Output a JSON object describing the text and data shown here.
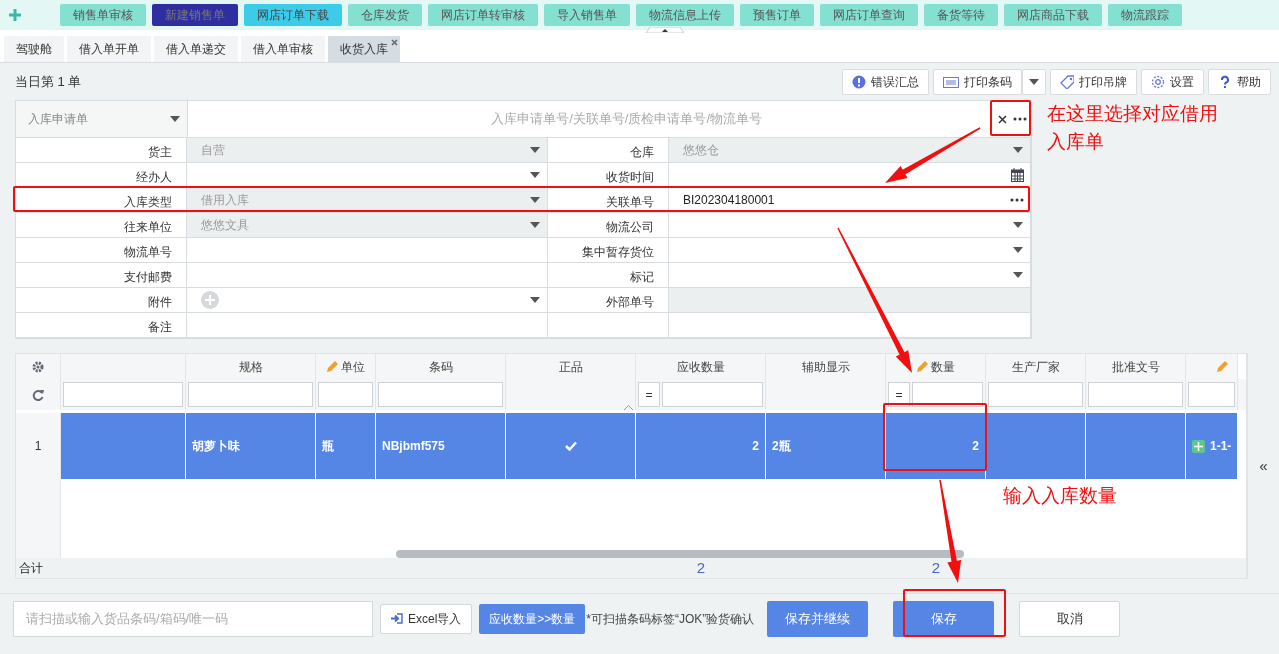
{
  "top_nav": {
    "buttons": [
      {
        "label": "销售单审核",
        "kind": "default"
      },
      {
        "label": "新建销售单",
        "kind": "active"
      },
      {
        "label": "网店订单下载",
        "kind": "hover"
      },
      {
        "label": "仓库发货",
        "kind": "default"
      },
      {
        "label": "网店订单转审核",
        "kind": "default"
      },
      {
        "label": "导入销售单",
        "kind": "default"
      },
      {
        "label": "物流信息上传",
        "kind": "default"
      },
      {
        "label": "预售订单",
        "kind": "default"
      },
      {
        "label": "网店订单查询",
        "kind": "default"
      },
      {
        "label": "备货等待",
        "kind": "default"
      },
      {
        "label": "网店商品下载",
        "kind": "default"
      },
      {
        "label": "物流跟踪",
        "kind": "default"
      }
    ]
  },
  "tabs": [
    {
      "label": "驾驶舱",
      "selected": false
    },
    {
      "label": "借入单开单",
      "selected": false
    },
    {
      "label": "借入单递交",
      "selected": false
    },
    {
      "label": "借入单审核",
      "selected": false
    },
    {
      "label": "收货入库",
      "selected": true
    }
  ],
  "order_count": "当日第 1 单",
  "toolbar": [
    {
      "label": "错误汇总",
      "kind": "plain"
    },
    {
      "label": "打印条码",
      "kind": "split"
    },
    {
      "label": "打印吊牌",
      "kind": "plain"
    },
    {
      "label": "设置",
      "kind": "plain"
    },
    {
      "label": "帮助",
      "kind": "plain"
    }
  ],
  "source": {
    "type": "入库申请单",
    "placeholder": "入库申请单号/关联单号/质检申请单号/物流单号"
  },
  "form": {
    "fields": [
      {
        "label": "货主",
        "value": "自营",
        "kind": "select",
        "disabled": true
      },
      {
        "label": "仓库",
        "value": "悠悠仓",
        "kind": "select",
        "disabled": true
      },
      {
        "label": "经办人",
        "kind": "select",
        "disabled": false
      },
      {
        "label": "收货时间",
        "kind": "date",
        "disabled": false
      },
      {
        "label": "入库类型",
        "value": "借用入库",
        "kind": "select",
        "disabled": true
      },
      {
        "label": "关联单号",
        "value": "BI202304180001",
        "kind": "lookup",
        "disabled": false
      },
      {
        "label": "往来单位",
        "value": "悠悠文具",
        "kind": "select",
        "disabled": true
      },
      {
        "label": "物流公司",
        "kind": "select",
        "disabled": false
      },
      {
        "label": "物流单号",
        "kind": "text",
        "disabled": false
      },
      {
        "label": "集中暂存货位",
        "kind": "select",
        "disabled": false
      },
      {
        "label": "支付邮费",
        "kind": "text",
        "disabled": false
      },
      {
        "label": "标记",
        "kind": "select",
        "disabled": false
      },
      {
        "label": "附件",
        "kind": "attachment",
        "disabled": false
      },
      {
        "label": "外部单号",
        "kind": "text",
        "disabled": true
      },
      {
        "label": "备注",
        "kind": "text",
        "disabled": false
      }
    ]
  },
  "grid": {
    "columns": [
      {
        "kind": "text",
        "editable": false,
        "filterable": true
      },
      {
        "label": "规格",
        "kind": "text",
        "editable": false,
        "filterable": true
      },
      {
        "label": "单位",
        "kind": "text",
        "editable": true,
        "filterable": true
      },
      {
        "label": "条码",
        "kind": "text",
        "editable": false,
        "filterable": true
      },
      {
        "label": "正品",
        "kind": "check",
        "editable": false,
        "filterable": false
      },
      {
        "label": "应收数量",
        "kind": "number",
        "editable": false,
        "filterable": true,
        "operator": "=",
        "total": "2"
      },
      {
        "label": "辅助显示",
        "kind": "text",
        "editable": false,
        "filterable": false
      },
      {
        "label": "数量",
        "kind": "number",
        "editable": true,
        "filterable": true,
        "operator": "=",
        "total": "2"
      },
      {
        "label": "生产厂家",
        "kind": "text",
        "editable": false,
        "filterable": true
      },
      {
        "label": "批准文号",
        "kind": "text",
        "editable": false,
        "filterable": true
      },
      {
        "kind": "location",
        "editable": true,
        "filterable": true
      }
    ],
    "rows": [
      {
        "number": "1",
        "selected": true,
        "cells": [
          {
            "kind": "blank"
          },
          {
            "text": "胡萝卜味"
          },
          {
            "text": "瓶"
          },
          {
            "text": "NBjbmf575"
          },
          {
            "checked": true
          },
          {
            "text": "2"
          },
          {
            "text": "2瓶"
          },
          {
            "text": "2"
          },
          {
            "kind": "blank"
          },
          {
            "kind": "blank"
          },
          {
            "text": "1-1-"
          }
        ]
      }
    ],
    "total_label": "合计",
    "side_toggle": "«"
  },
  "scan": {
    "placeholder": "请扫描或输入货品条码/箱码/唯一码"
  },
  "actions": [
    {
      "label": "Excel导入",
      "kind": "import"
    },
    {
      "label": "应收数量>>数量",
      "kind": "primary"
    }
  ],
  "note": "*可扫描条码标签“JOK”验货确认",
  "buttons": [
    {
      "label": "保存并继续",
      "kind": "primary"
    },
    {
      "label": "保存",
      "kind": "primary"
    },
    {
      "label": "取消",
      "kind": "default"
    }
  ],
  "annotations": [
    {
      "text": "在这里选择对应借用入库单"
    },
    {
      "text": "输入入库数量"
    }
  ]
}
